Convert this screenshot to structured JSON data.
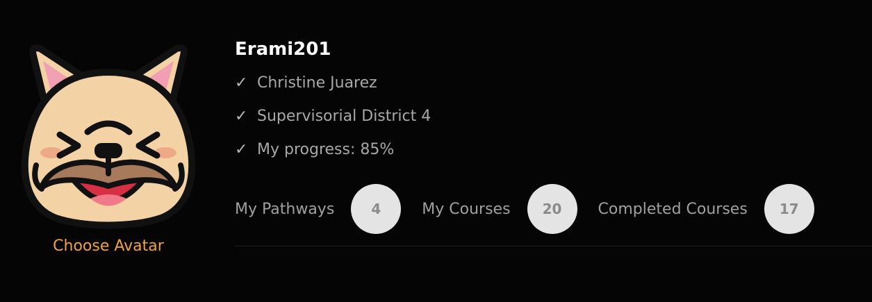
{
  "profile": {
    "username": "Erami201",
    "choose_avatar_label": "Choose Avatar",
    "avatar_icon": "french-bulldog-face"
  },
  "info": [
    {
      "check": "✓",
      "text": "Christine Juarez"
    },
    {
      "check": "✓",
      "text": "Supervisorial District 4"
    },
    {
      "check": "✓",
      "text": "My progress: 85%"
    }
  ],
  "stats": [
    {
      "label": "My Pathways",
      "value": "4"
    },
    {
      "label": "My Courses",
      "value": "20"
    },
    {
      "label": "Completed Courses",
      "value": "17"
    }
  ],
  "colors": {
    "background": "#060505",
    "accent": "#f2a23a",
    "username": "#ffffff",
    "muted_text": "#a8a8a8",
    "badge_bg": "#e4e4e4",
    "badge_text": "#8a8a8a"
  }
}
